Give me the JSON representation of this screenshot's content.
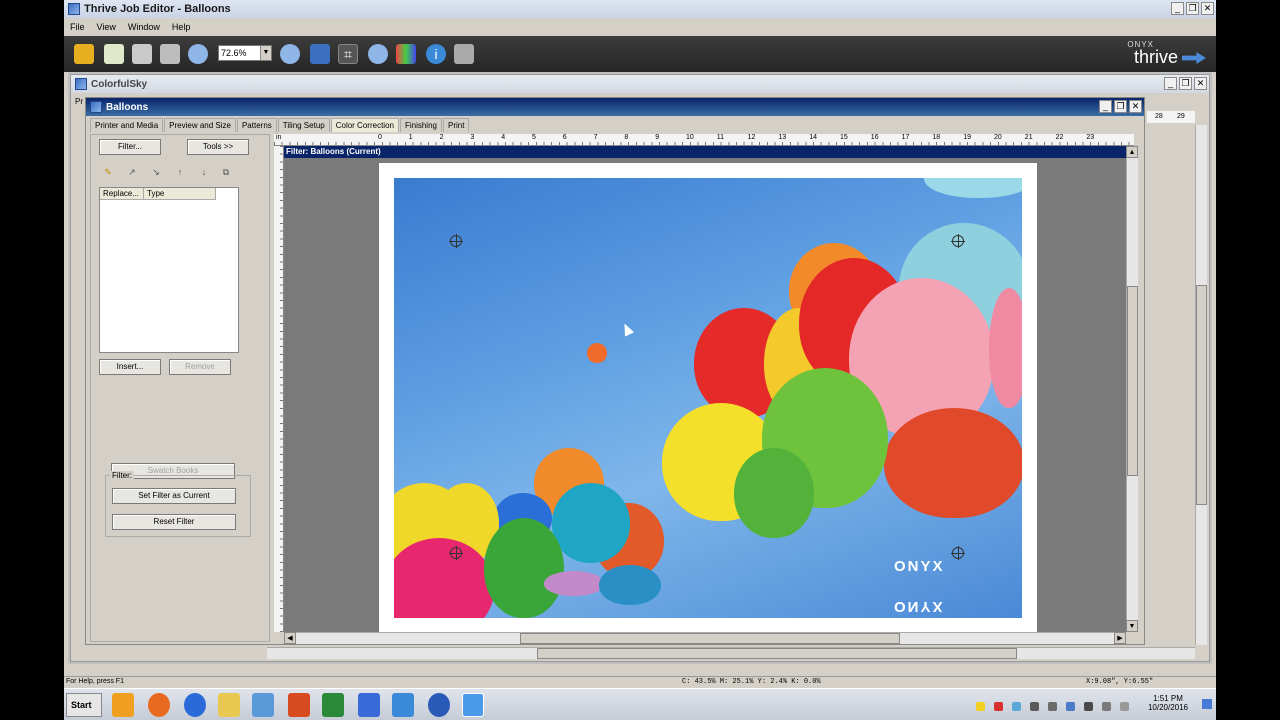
{
  "app": {
    "title": "Thrive Job Editor - Balloons",
    "menu": [
      "File",
      "View",
      "Window",
      "Help"
    ],
    "zoom": "72.6%",
    "brand_small": "ONYX",
    "brand_big": "thrive"
  },
  "window_controls": {
    "minimize": "_",
    "restore": "❐",
    "close": "✕"
  },
  "child_window": {
    "title": "ColorfulSky",
    "side_label": "Pr"
  },
  "job_window": {
    "title": "Balloons",
    "tabs": [
      "Printer and Media",
      "Preview and Size",
      "Patterns",
      "Tiling Setup",
      "Color Correction",
      "Finishing",
      "Print"
    ],
    "active_tab": "Color Correction"
  },
  "left_panel": {
    "filter_button": "Filter...",
    "tools_button": "Tools >>",
    "list_headers": [
      "Replace...",
      "Type"
    ],
    "insert_button": "Insert...",
    "remove_button": "Remove",
    "swatch_button": "Swatch Books",
    "group_label": "Filter:",
    "set_filter_button": "Set Filter as Current",
    "reset_filter_button": "Reset Filter"
  },
  "preview": {
    "ruler_unit": "in",
    "ruler_numbers": [
      "0",
      "1",
      "2",
      "3",
      "4",
      "5",
      "6",
      "7",
      "8",
      "9",
      "10",
      "11",
      "12",
      "13",
      "14",
      "15",
      "16",
      "17",
      "18",
      "19",
      "20",
      "21",
      "22",
      "23"
    ],
    "filter_bar": "Filter: Balloons (Current)",
    "watermark": "ONYX",
    "side_ruler": [
      "28",
      "29"
    ]
  },
  "statusbar": {
    "help": "For Help, press F1",
    "color": "C: 43.5%  M: 25.1%  Y:  2.4%  K:  0.0%",
    "coords": "X:9.08\", Y:6.55\""
  },
  "taskbar": {
    "start": "Start",
    "time": "1:51 PM",
    "date": "10/20/2016"
  },
  "colors": {
    "toolbar_bg": "#262626",
    "title_active": "#0a246a",
    "sky": "#5d9ee2"
  }
}
